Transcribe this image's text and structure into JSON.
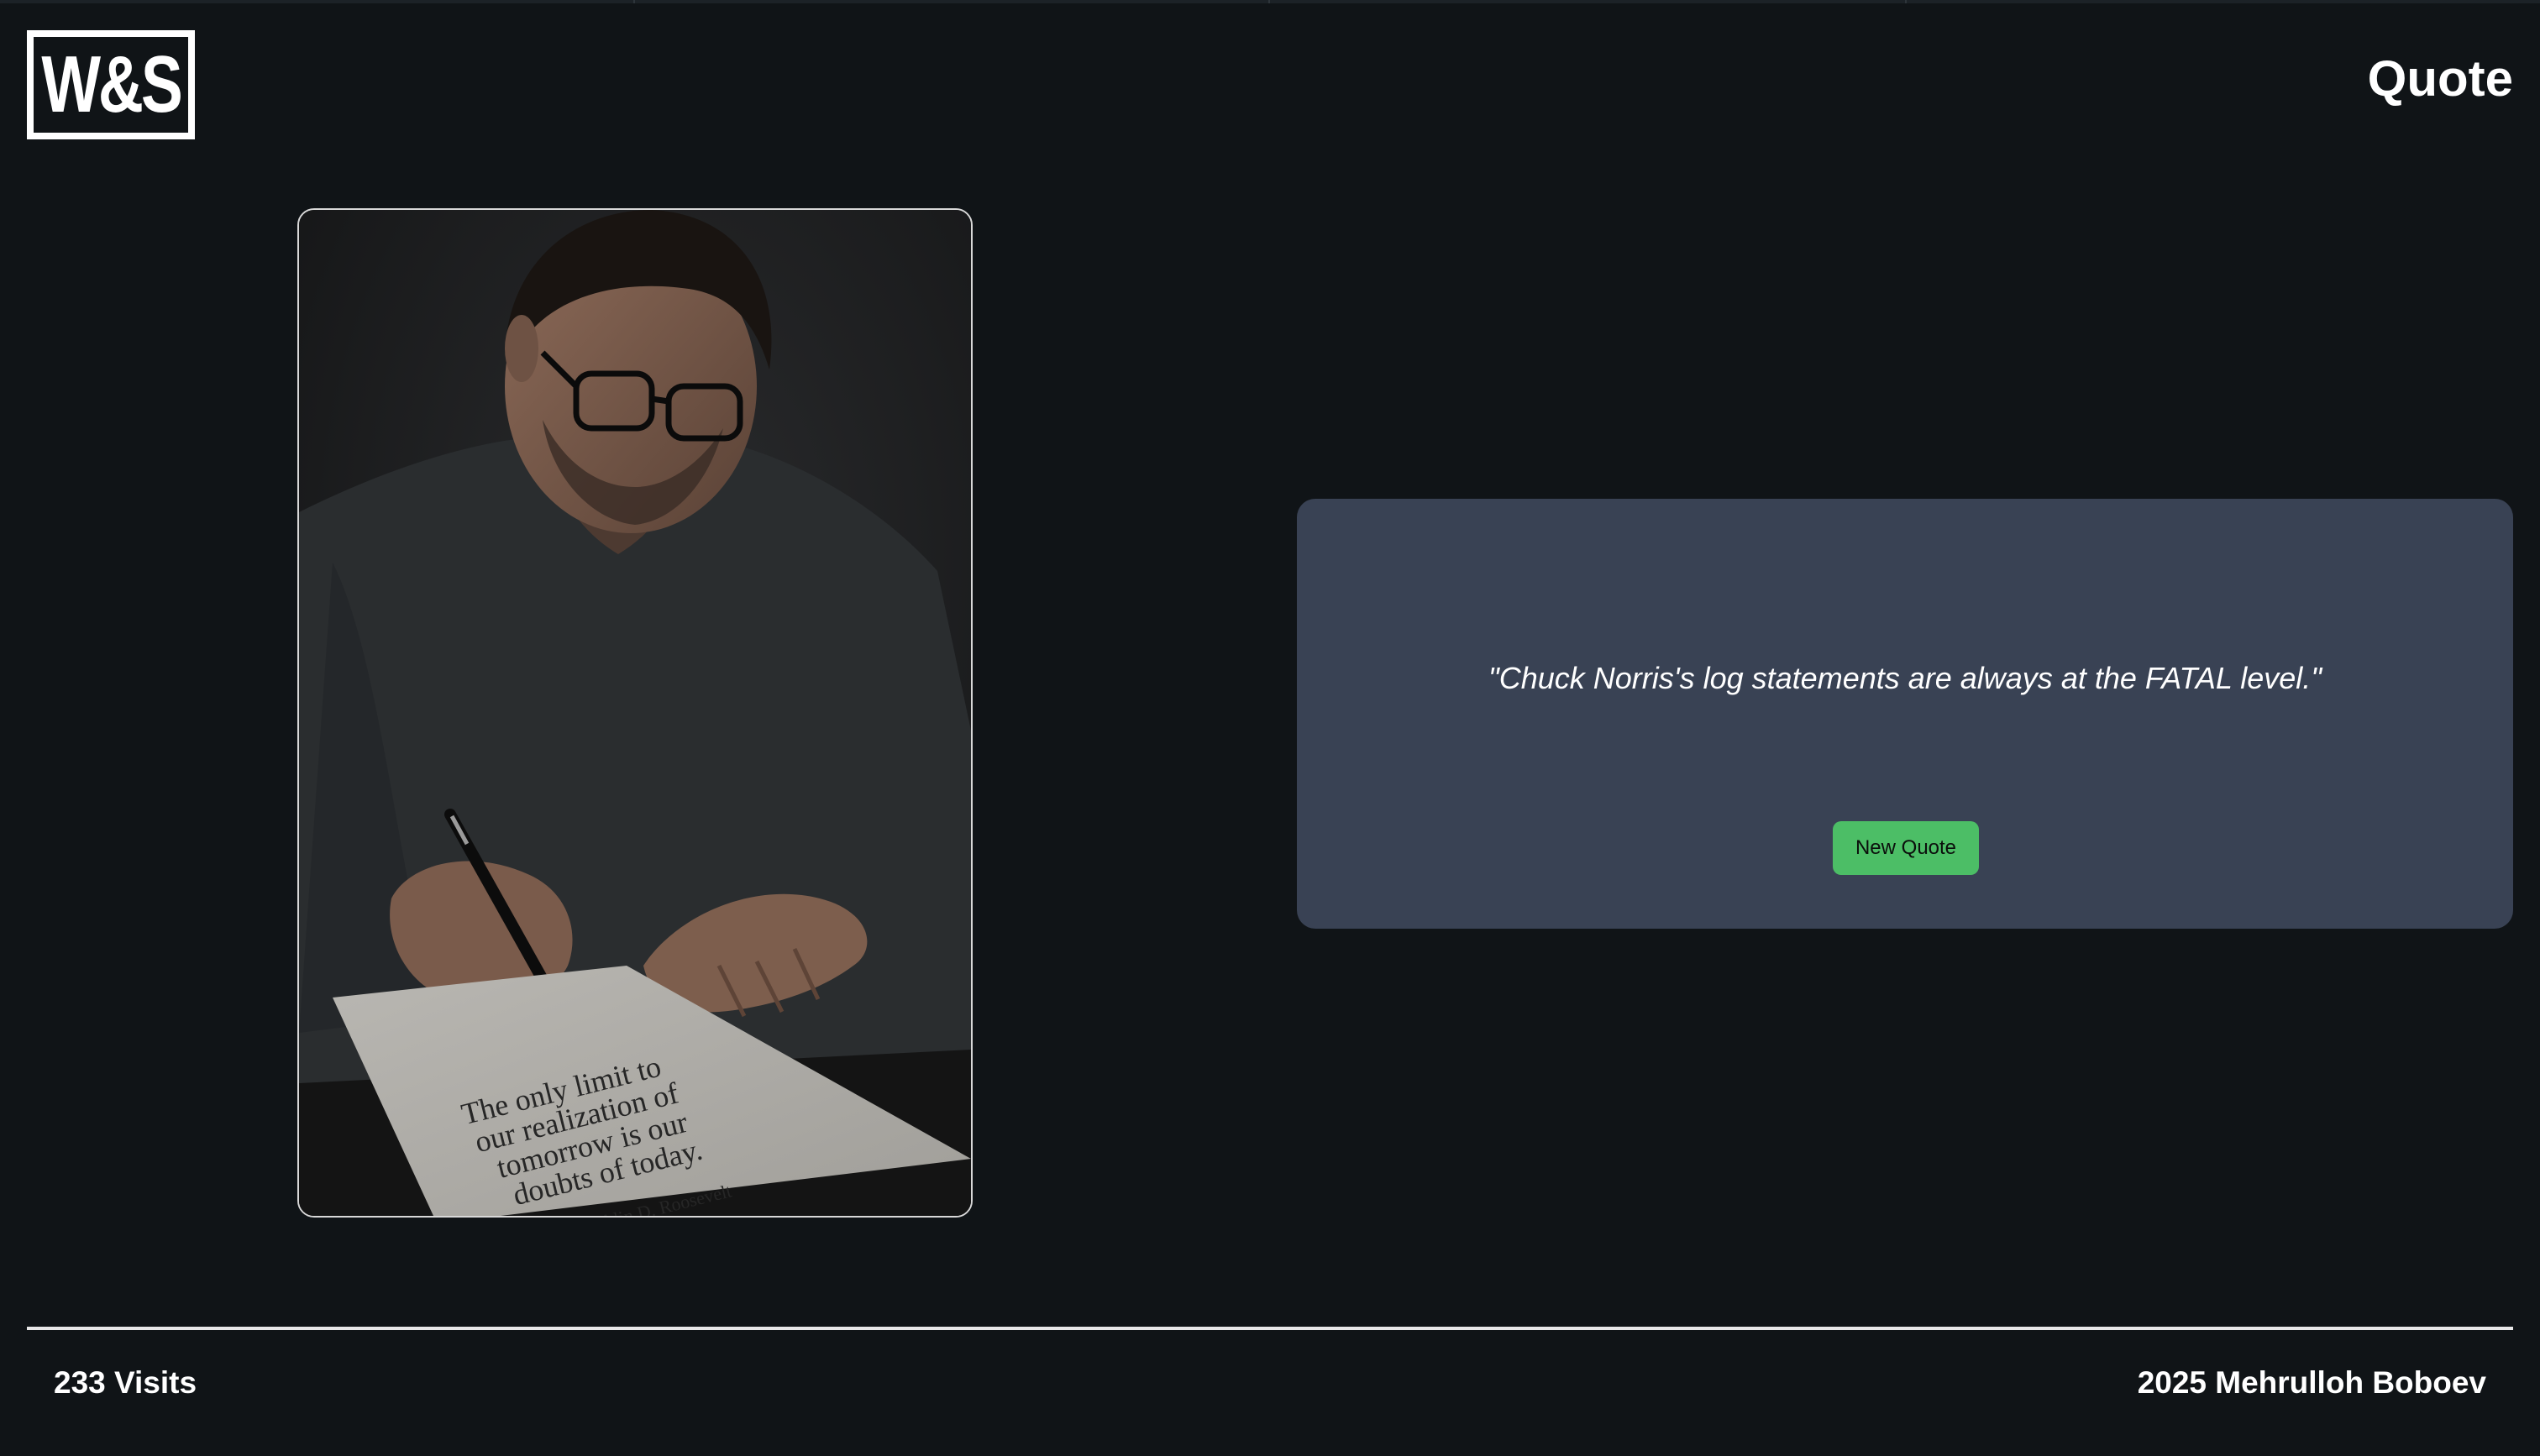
{
  "header": {
    "logo_text": "W&S",
    "title": "Quote"
  },
  "image": {
    "description_icon": "man-writing-quote-photo",
    "paper_lines": [
      "The only limit to",
      "our realization of",
      "tomorrow is our",
      "doubts of today."
    ],
    "paper_attribution": "Franklin D. Roosevelt"
  },
  "quote": {
    "text": "\"Chuck Norris's log statements are always at the FATAL level.\"",
    "button_label": "New Quote"
  },
  "footer": {
    "visits": "233 Visits",
    "copyright": "2025 Mehrulloh Boboev"
  },
  "colors": {
    "background": "#101417",
    "card": "#394254",
    "button": "#4cbe66"
  }
}
